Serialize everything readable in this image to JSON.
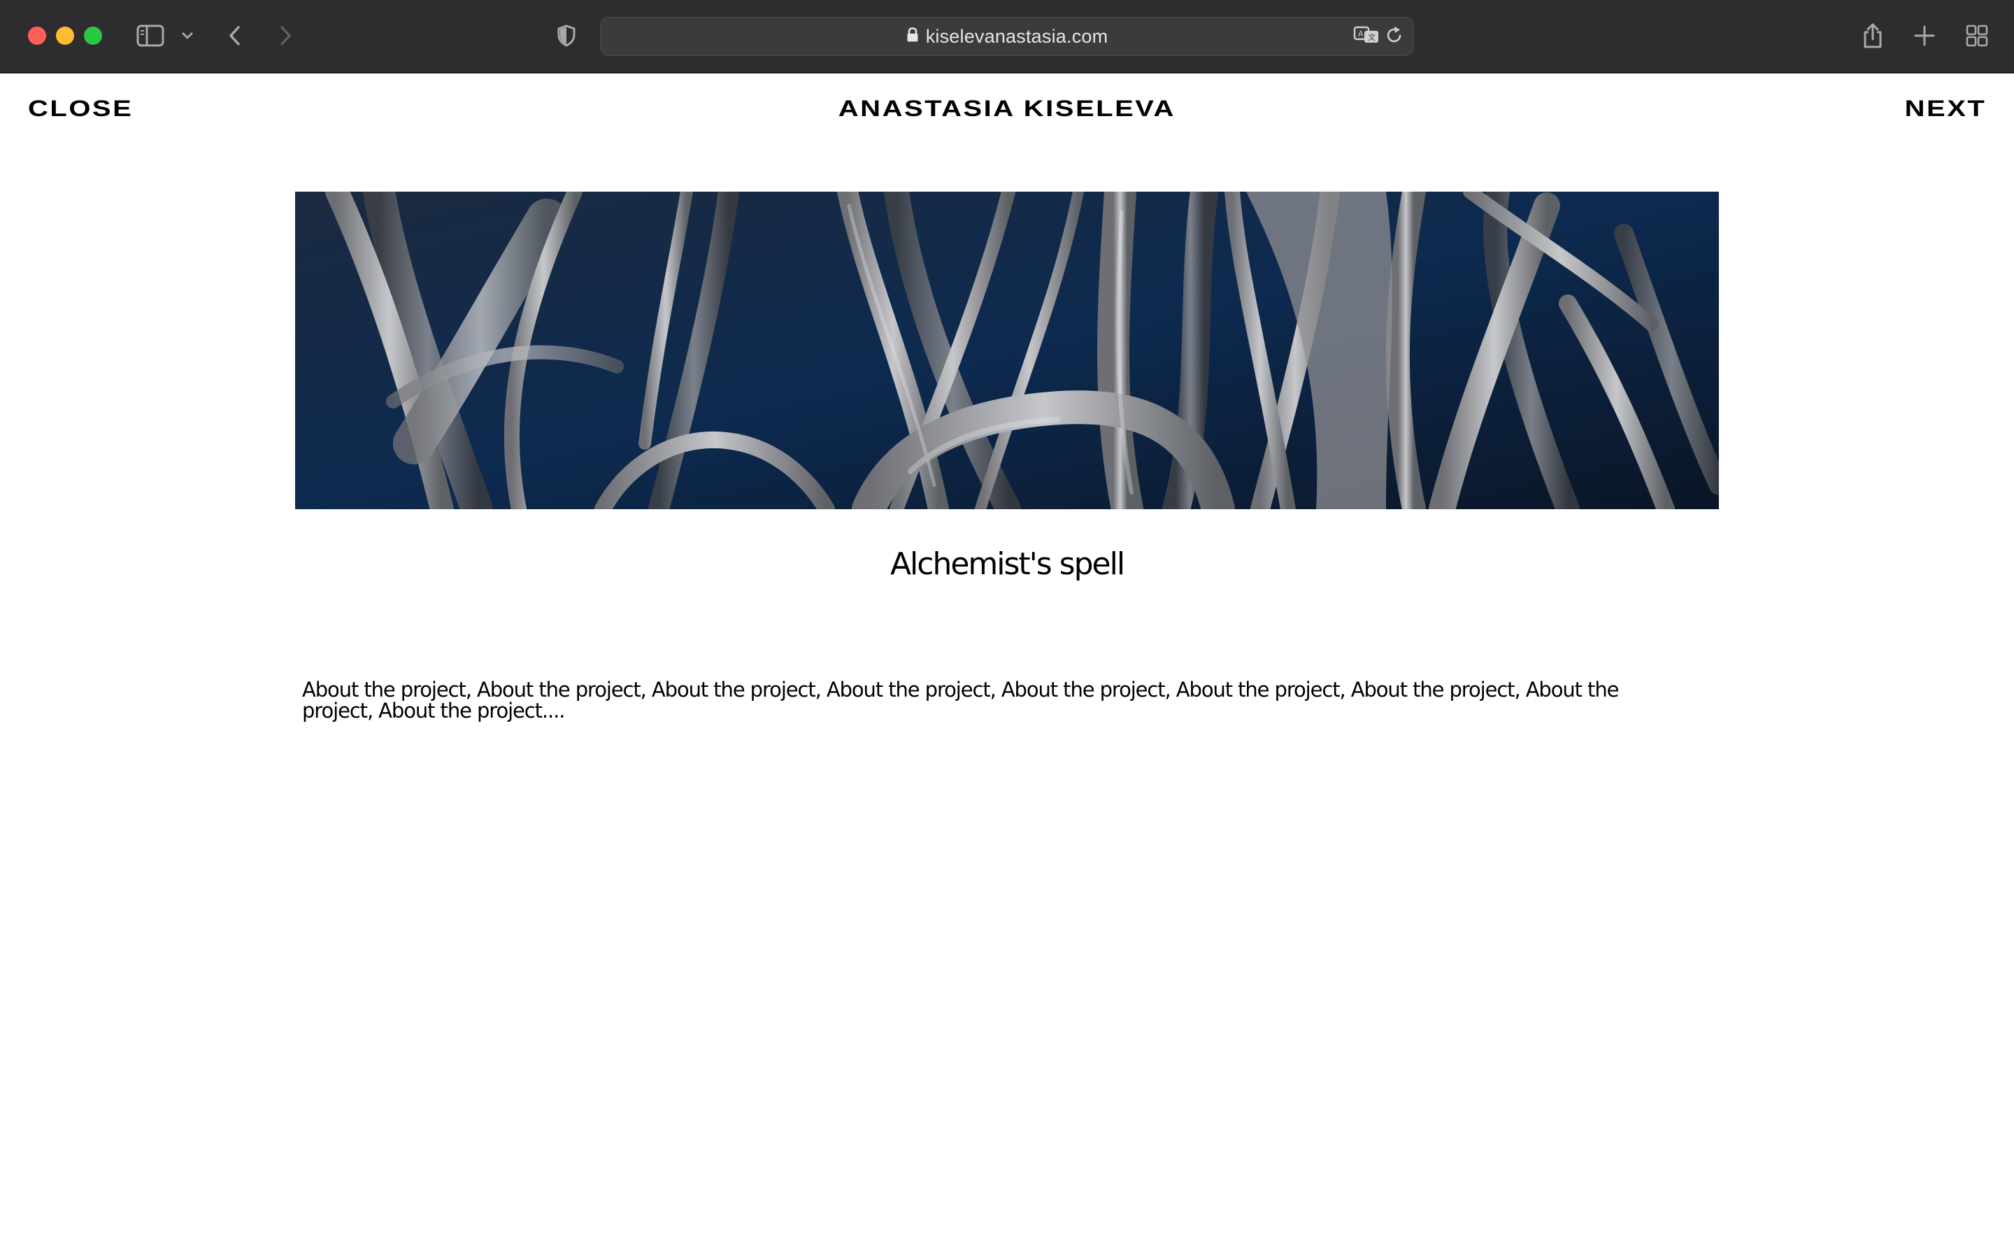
{
  "browser": {
    "url": "kiselevanastasia.com",
    "icons": {
      "sidebar": "sidebar-icon",
      "sidebar_menu": "chevron-down-icon",
      "back": "chevron-left-icon",
      "forward": "chevron-right-icon",
      "privacy": "shield-icon",
      "lock": "lock-icon",
      "translate": "translate-icon",
      "reload": "reload-icon",
      "share": "share-icon",
      "new_tab": "plus-icon",
      "tab_overview": "grid-icon"
    }
  },
  "header": {
    "close_label": "CLOSE",
    "site_title": "ANASTASIA KISELEVA",
    "next_label": "NEXT"
  },
  "project": {
    "image_subject": "White sculptural branches against a dark blue background",
    "title": "Alchemist's spell",
    "description": "About the project, About the project, About the project, About the project, About the project, About the project, About the project, About the project, About the project...."
  },
  "colors": {
    "chrome_bg": "#2d2d2f",
    "page_bg": "#ffffff",
    "text": "#000000",
    "hero_bg": "#0e1f36"
  }
}
